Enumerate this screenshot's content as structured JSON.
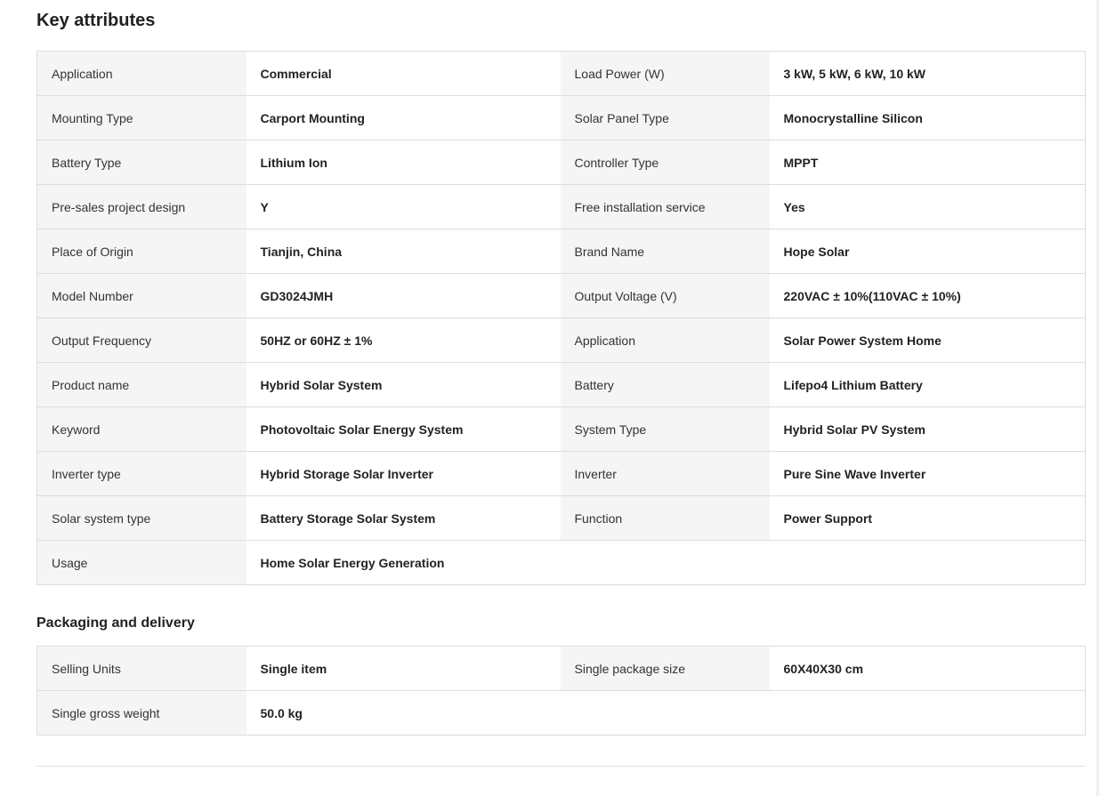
{
  "key_attributes": {
    "title": "Key attributes",
    "rows": [
      {
        "l1": "Application",
        "v1": "Commercial",
        "l2": "Load Power (W)",
        "v2": "3 kW, 5 kW, 6 kW, 10 kW"
      },
      {
        "l1": "Mounting Type",
        "v1": "Carport Mounting",
        "l2": "Solar Panel Type",
        "v2": "Monocrystalline Silicon"
      },
      {
        "l1": "Battery Type",
        "v1": "Lithium Ion",
        "l2": "Controller Type",
        "v2": "MPPT"
      },
      {
        "l1": "Pre-sales project design",
        "v1": "Y",
        "l2": "Free installation service",
        "v2": "Yes"
      },
      {
        "l1": "Place of Origin",
        "v1": "Tianjin, China",
        "l2": "Brand Name",
        "v2": "Hope Solar"
      },
      {
        "l1": "Model Number",
        "v1": "GD3024JMH",
        "l2": "Output Voltage (V)",
        "v2": "220VAC ± 10%(110VAC ± 10%)"
      },
      {
        "l1": "Output Frequency",
        "v1": "50HZ or 60HZ ± 1%",
        "l2": "Application",
        "v2": "Solar Power System Home"
      },
      {
        "l1": "Product name",
        "v1": "Hybrid Solar System",
        "l2": "Battery",
        "v2": "Lifepo4 Lithium Battery"
      },
      {
        "l1": "Keyword",
        "v1": "Photovoltaic Solar Energy System",
        "l2": "System Type",
        "v2": "Hybrid Solar PV System"
      },
      {
        "l1": "Inverter type",
        "v1": "Hybrid Storage Solar Inverter",
        "l2": "Inverter",
        "v2": "Pure Sine Wave Inverter"
      },
      {
        "l1": "Solar system type",
        "v1": "Battery Storage Solar System",
        "l2": "Function",
        "v2": "Power Support"
      },
      {
        "l1": "Usage",
        "v1": "Home Solar Energy Generation"
      }
    ]
  },
  "packaging": {
    "title": "Packaging and delivery",
    "rows": [
      {
        "l1": "Selling Units",
        "v1": "Single item",
        "l2": "Single package size",
        "v2": "60X40X30 cm"
      },
      {
        "l1": "Single gross weight",
        "v1": "50.0 kg"
      }
    ]
  }
}
